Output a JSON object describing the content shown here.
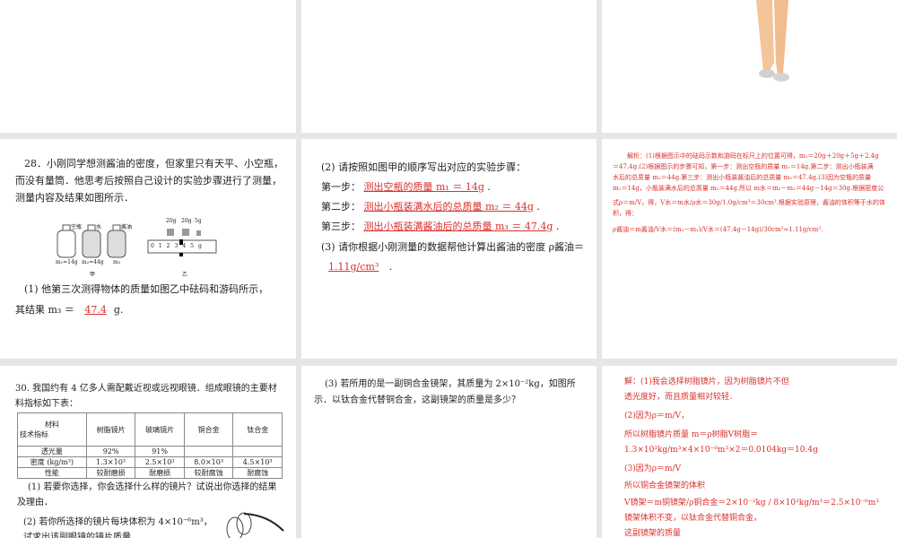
{
  "slides": {
    "s28a": {
      "q": "28．小刚同学想测酱油的密度，但家里只有天平、小空瓶，而没有量筒．他思考后按照自己设计的实验步骤进行了测量，测量内容及结果如图所示．",
      "fig": {
        "b1": "空瓶",
        "b2": "水",
        "b3": "酱油",
        "m1": "m₁=14g",
        "m2": "m₂=44g",
        "m3": "m₃",
        "jia": "甲",
        "yi": "乙",
        "w1": "20g",
        "w2": "20g",
        "w3": "5g",
        "scale": [
          "0",
          "1",
          "2",
          "3",
          "4",
          "5g"
        ]
      },
      "p1": "(1) 他第三次测得物体的质量如图乙中砝码和游码所示，",
      "p1b": "其结果 m₃ ＝",
      "ans": "47.4",
      "unit": "g."
    },
    "s28b": {
      "p2": "(2) 请按照如图甲的顺序写出对应的实验步骤：",
      "steps": [
        {
          "label": "第一步：",
          "ans": "测出空瓶的质量 m₁ ＝ 14g"
        },
        {
          "label": "第二步：",
          "ans": "测出小瓶装满水后的总质量 m₂ ＝ 44g"
        },
        {
          "label": "第三步：",
          "ans": "测出小瓶装满酱油后的总质量 m₃ ＝ 47.4g"
        }
      ],
      "p3": "(3) 请你根据小刚测量的数据帮他计算出酱油的密度 ρ酱油＝",
      "ans": "1.11g/cm³"
    },
    "s28c": {
      "lines": [
        "解析：(1)根据图示中的砝码示数和游码在标尺上的位置可得，m₃＝20g＋20g＋5g＋2.4g",
        "＝47.4g.(2)根据图示的步骤可知，第一步：测出空瓶的质量 m₁＝14g.第二步：测出小瓶装满",
        "水后的总质量 m₂＝44g.第三步：测出小瓶装酱油后的总质量 m₃＝47.4g.(3)因为空瓶的质量",
        "m₁＝14g，小瓶装满水后的总质量 m₂＝44g.所以 m水＝m₂－m₁＝44g－14g＝30g.根据密度公",
        "式ρ＝m/V，得，V水＝m水/ρ水＝30g/1.0g/cm³＝30cm³.根据实验原理，酱油的体积等于水的体积，得：",
        "ρ酱油＝m酱油/V水＝(m₃－m₁)/V水＝(47.4g－14g)/30cm³≈1.11g/cm³."
      ]
    },
    "s30a": {
      "q": "30. 我国约有 4 亿多人需配戴近视或远视眼镜．组成眼镜的主要材料指标如下表：",
      "table": {
        "corner": [
          "材料",
          "技术指标"
        ],
        "cols": [
          "树脂镜片",
          "玻璃镜片",
          "铜合金",
          "钛合金"
        ],
        "rows": [
          [
            "透光量",
            "92%",
            "91%",
            "",
            ""
          ],
          [
            "密度 (kg/m³)",
            "1.3×10³",
            "2.5×10³",
            "8.0×10³",
            "4.5×10³"
          ],
          [
            "性能",
            "较耐磨损",
            "耐磨损",
            "较耐腐蚀",
            "耐腐蚀"
          ]
        ]
      },
      "p1": "(1) 若要你选择，你会选择什么样的镜片？试说出你选择的结果及理由．",
      "p2": "(2) 若你所选择的镜片每块体积为 4×10⁻⁶m³，试求出该副眼镜的镜片质量．"
    },
    "s30b": {
      "p3": "(3) 若所用的是一副铜合金镜架，其质量为 2×10⁻²kg，如图所示．以钛合金代替铜合金，这副镜架的质量是多少？"
    },
    "s30c": {
      "lines": [
        "解：(1)我会选择树脂镜片，因为树脂镜片不但",
        "透光度好，而且质量相对较轻．",
        "(2)因为ρ＝m/V，",
        "所以树脂镜片质量 m＝ρ树脂V树脂＝",
        "1.3×10³kg/m³×4×10⁻⁶m³×2＝0.0104kg＝10.4g",
        "(3)因为ρ＝m/V",
        "所以铜合金镜架的体积",
        "V镜架＝m铜镜架/ρ铜合金＝2×10⁻²kg / 8×10³kg/m³＝2.5×10⁻⁶m³",
        "镜架体积不变，以钛合金代替铜合金，",
        "这副镜架的质量"
      ]
    }
  }
}
